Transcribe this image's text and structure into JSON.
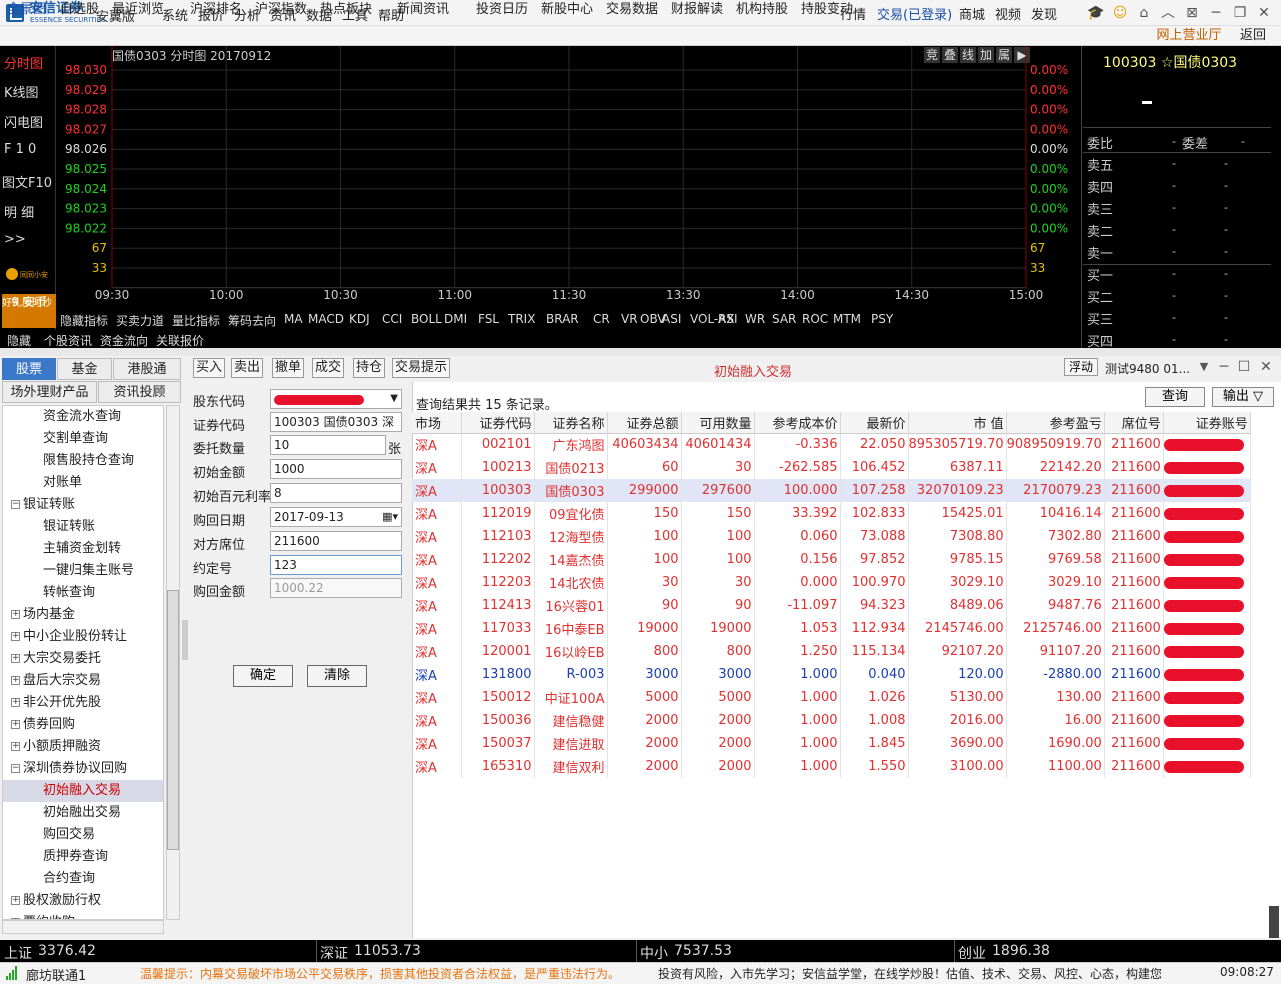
{
  "app": {
    "brand": "安信证券",
    "brand_sub": "ESSENCE SECURITIES",
    "edition": "安翼版"
  },
  "menu": [
    "系统",
    "报价",
    "分析",
    "资讯",
    "数据",
    "工具",
    "帮助"
  ],
  "title_right": {
    "market": "行情",
    "trade": "交易(已登录)",
    "mall": "商城",
    "video": "视频",
    "discover": "发现"
  },
  "nav": [
    "全景图",
    "自选股",
    "最近浏览",
    "沪深排名",
    "沪深指数",
    "热点板块",
    "新闻资讯",
    "投资日历",
    "新股中心",
    "交易数据",
    "财报解读",
    "机构持股",
    "持股变动"
  ],
  "nav_online": "网上营业厅",
  "nav_back": "返回",
  "left_tabs": [
    "分时图",
    "K线图",
    "闪电图",
    "F 1 0",
    "图文F10",
    "明  细",
    ">>"
  ],
  "promo": {
    "label": "同同小安",
    "line1": "9 安币",
    "line2": "好礼限时秒"
  },
  "chart": {
    "title": "国债0303 分时图 20170912",
    "tools": [
      "竞",
      "叠",
      "线",
      "加",
      "属",
      "▶"
    ],
    "y_left": [
      "98.030",
      "98.029",
      "98.028",
      "98.027",
      "98.026",
      "98.025",
      "98.024",
      "98.023",
      "98.022",
      "67",
      "33"
    ],
    "y_right": [
      "0.00%",
      "0.00%",
      "0.00%",
      "0.00%",
      "0.00%",
      "0.00%",
      "0.00%",
      "0.00%",
      "0.00%",
      "67",
      "33"
    ],
    "x_labels": [
      "09:30",
      "10:00",
      "10:30",
      "11:00",
      "11:30",
      "13:30",
      "14:00",
      "14:30",
      "15:00"
    ]
  },
  "indicators": [
    "隐藏指标",
    "买卖力道",
    "量比指标",
    "筹码去向",
    "MA",
    "MACD",
    "KDJ",
    "CCI",
    "BOLL",
    "DMI",
    "FSL",
    "TRIX",
    "BRAR",
    "CR",
    "VR",
    "OBV",
    "ASI",
    "VOL-AX",
    "RSI",
    "WR",
    "SAR",
    "ROC",
    "MTM",
    "PSY"
  ],
  "sub_tabs": [
    "隐藏",
    "个股资讯",
    "资金流向",
    "关联报价"
  ],
  "quote": {
    "title": "100303 ☆国债0303",
    "weibi": "委比",
    "weicha": "委差",
    "rows": [
      "卖五",
      "卖四",
      "卖三",
      "卖二",
      "卖一",
      "买一",
      "买二",
      "买三",
      "买四"
    ],
    "dash": "-"
  },
  "tree_tabs1": [
    "股票",
    "基金",
    "港股通"
  ],
  "tree_tabs2": [
    "场外理财产品",
    "资讯投顾"
  ],
  "tree": [
    {
      "label": "资金流水查询",
      "indent": 2
    },
    {
      "label": "交割单查询",
      "indent": 2
    },
    {
      "label": "限售股持仓查询",
      "indent": 2
    },
    {
      "label": "对账单",
      "indent": 2
    },
    {
      "label": "银证转账",
      "indent": 0,
      "box": "−"
    },
    {
      "label": "银证转账",
      "indent": 2
    },
    {
      "label": "主辅资金划转",
      "indent": 2
    },
    {
      "label": "一键归集主账号",
      "indent": 2
    },
    {
      "label": "转帐查询",
      "indent": 2
    },
    {
      "label": "场内基金",
      "indent": 0,
      "box": "+"
    },
    {
      "label": "中小企业股份转让",
      "indent": 0,
      "box": "+"
    },
    {
      "label": "大宗交易委托",
      "indent": 0,
      "box": "+"
    },
    {
      "label": "盘后大宗交易",
      "indent": 0,
      "box": "+"
    },
    {
      "label": "非公开优先股",
      "indent": 0,
      "box": "+"
    },
    {
      "label": "债券回购",
      "indent": 0,
      "box": "+"
    },
    {
      "label": "小额质押融资",
      "indent": 0,
      "box": "+"
    },
    {
      "label": "深圳债券协议回购",
      "indent": 0,
      "box": "−"
    },
    {
      "label": "初始融入交易",
      "indent": 2,
      "selected": true
    },
    {
      "label": "初始融出交易",
      "indent": 2
    },
    {
      "label": "购回交易",
      "indent": 2
    },
    {
      "label": "质押券查询",
      "indent": 2
    },
    {
      "label": "合约查询",
      "indent": 2
    },
    {
      "label": "股权激励行权",
      "indent": 0,
      "box": "+"
    },
    {
      "label": "要约收购",
      "indent": 0,
      "box": "+"
    }
  ],
  "trade_buttons": [
    "买入",
    "卖出",
    "撤单",
    "成交",
    "持仓",
    "交易提示"
  ],
  "trade_title": "初始融入交易",
  "float_label": "浮动",
  "account_label": "测试9480  01...",
  "form": {
    "labels": [
      "股东代码",
      "证券代码",
      "委托数量",
      "初始金额",
      "初始百元利率",
      "购回日期",
      "对方席位",
      "约定号",
      "购回金额"
    ],
    "values": [
      "",
      "100303 国债0303  深",
      "10",
      "1000",
      "8",
      "2017-09-13",
      "211600",
      "123",
      "1000.22"
    ],
    "unit": "张",
    "confirm": "确定",
    "clear": "清除"
  },
  "results": {
    "summary": "查询结果共 15 条记录。",
    "query_btn": "查询",
    "export_btn": "输出 ▽",
    "headers": [
      "市场",
      "证券代码",
      "证券名称",
      "证券总额",
      "可用数量",
      "参考成本价",
      "最新价",
      "市  值",
      "参考盈亏",
      "席位号",
      "证券账号"
    ],
    "rows": [
      [
        "深A",
        "002101",
        "广东鸿图",
        "40603434",
        "40601434",
        "-0.336",
        "22.050",
        "895305719.70",
        "908950919.70",
        "211600",
        ""
      ],
      [
        "深A",
        "100213",
        "国债0213",
        "60",
        "30",
        "-262.585",
        "106.452",
        "6387.11",
        "22142.20",
        "211600",
        ""
      ],
      [
        "深A",
        "100303",
        "国债0303",
        "299000",
        "297600",
        "100.000",
        "107.258",
        "32070109.23",
        "2170079.23",
        "211600",
        ""
      ],
      [
        "深A",
        "112019",
        "09宜化债",
        "150",
        "150",
        "33.392",
        "102.833",
        "15425.01",
        "10416.14",
        "211600",
        ""
      ],
      [
        "深A",
        "112103",
        "12海型债",
        "100",
        "100",
        "0.060",
        "73.088",
        "7308.80",
        "7302.80",
        "211600",
        ""
      ],
      [
        "深A",
        "112202",
        "14嘉杰债",
        "100",
        "100",
        "0.156",
        "97.852",
        "9785.15",
        "9769.58",
        "211600",
        ""
      ],
      [
        "深A",
        "112203",
        "14北农债",
        "30",
        "30",
        "0.000",
        "100.970",
        "3029.10",
        "3029.10",
        "211600",
        ""
      ],
      [
        "深A",
        "112413",
        "16兴蓉01",
        "90",
        "90",
        "-11.097",
        "94.323",
        "8489.06",
        "9487.76",
        "211600",
        ""
      ],
      [
        "深A",
        "117033",
        "16中泰EB",
        "19000",
        "19000",
        "1.053",
        "112.934",
        "2145746.00",
        "2125746.00",
        "211600",
        ""
      ],
      [
        "深A",
        "120001",
        "16以岭EB",
        "800",
        "800",
        "1.250",
        "115.134",
        "92107.20",
        "91107.20",
        "211600",
        ""
      ],
      [
        "深A",
        "131800",
        "R-003",
        "3000",
        "3000",
        "1.000",
        "0.040",
        "120.00",
        "-2880.00",
        "211600",
        ""
      ],
      [
        "深A",
        "150012",
        "中证100A",
        "5000",
        "5000",
        "1.000",
        "1.026",
        "5130.00",
        "130.00",
        "211600",
        ""
      ],
      [
        "深A",
        "150036",
        "建信稳健",
        "2000",
        "2000",
        "1.000",
        "1.008",
        "2016.00",
        "16.00",
        "211600",
        ""
      ],
      [
        "深A",
        "150037",
        "建信进取",
        "2000",
        "2000",
        "1.000",
        "1.845",
        "3690.00",
        "1690.00",
        "211600",
        ""
      ],
      [
        "深A",
        "165310",
        "建信双利",
        "2000",
        "2000",
        "1.000",
        "1.550",
        "3100.00",
        "1100.00",
        "211600",
        ""
      ]
    ],
    "highlight_row": 2,
    "blue_row": 10
  },
  "status": {
    "indices": [
      {
        "name": "上证",
        "value": "3376.42"
      },
      {
        "name": "深证",
        "value": "11053.73"
      },
      {
        "name": "中小",
        "value": "7537.53"
      },
      {
        "name": "创业",
        "value": "1896.38"
      }
    ],
    "connection": "廊坊联通1",
    "warning": "温馨提示：内幕交易破坏市场公平交易秩序，损害其他投资者合法权益，是严重违法行为。",
    "ticker": "投资有风险，入市先学习；安信益学堂，在线学炒股！估值、技术、交易、风控、心态，构建您",
    "time": "09:08:27"
  },
  "colors": {
    "accent": "#3b78c8",
    "up": "#e03030",
    "chart_bg": "#000000",
    "promo": "#d47800"
  }
}
